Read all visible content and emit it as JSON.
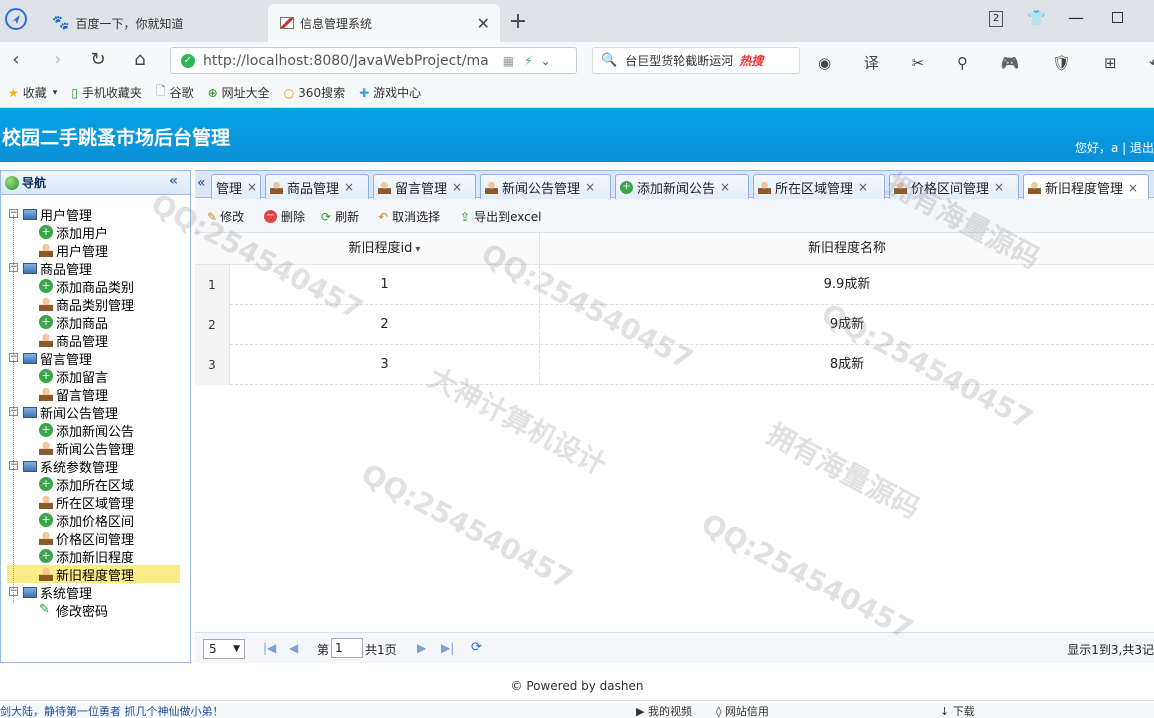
{
  "browser": {
    "tabs": [
      {
        "title": "百度一下，你就知道"
      },
      {
        "title": "信息管理系统"
      }
    ],
    "tab_count": "2",
    "url": "http://localhost:8080/JavaWebProject/ma",
    "search_text": "台巨型货轮截断运河",
    "hot_label": "热搜",
    "bookmarks": [
      "收藏",
      "手机收藏夹",
      "谷歌",
      "网址大全",
      "360搜索",
      "游戏中心"
    ]
  },
  "app": {
    "title": "校园二手跳蚤市场后台管理",
    "welcome": "您好，a | 退出"
  },
  "nav": {
    "header": "导航",
    "groups": [
      {
        "label": "用户管理",
        "items": [
          "添加用户",
          "用户管理"
        ]
      },
      {
        "label": "商品管理",
        "items": [
          "添加商品类别",
          "商品类别管理",
          "添加商品",
          "商品管理"
        ]
      },
      {
        "label": "留言管理",
        "items": [
          "添加留言",
          "留言管理"
        ]
      },
      {
        "label": "新闻公告管理",
        "items": [
          "添加新闻公告",
          "新闻公告管理"
        ]
      },
      {
        "label": "系统参数管理",
        "items": [
          "添加所在区域",
          "所在区域管理",
          "添加价格区间",
          "价格区间管理",
          "添加新旧程度",
          "新旧程度管理"
        ]
      },
      {
        "label": "系统管理",
        "items": [
          "修改密码"
        ]
      }
    ]
  },
  "tabs": [
    {
      "label": "管理"
    },
    {
      "label": "商品管理"
    },
    {
      "label": "留言管理"
    },
    {
      "label": "新闻公告管理"
    },
    {
      "label": "添加新闻公告"
    },
    {
      "label": "所在区域管理"
    },
    {
      "label": "价格区间管理"
    },
    {
      "label": "新旧程度管理"
    }
  ],
  "toolbar": {
    "edit": "修改",
    "delete": "删除",
    "refresh": "刷新",
    "cancel_select": "取消选择",
    "export": "导出到excel"
  },
  "grid": {
    "columns": [
      "新旧程度id",
      "新旧程度名称"
    ],
    "rows": [
      {
        "num": "1",
        "id": "1",
        "name": "9.9成新"
      },
      {
        "num": "2",
        "id": "2",
        "name": "9成新"
      },
      {
        "num": "3",
        "id": "3",
        "name": "8成新"
      }
    ]
  },
  "pager": {
    "page_size": "5",
    "page_label": "第",
    "page_value": "1",
    "total_pages": "共1页",
    "summary": "显示1到3,共3记"
  },
  "footer": {
    "text": "© Powered by dashen"
  },
  "statusbar": {
    "left": "剑大陆，静待第一位勇者 抓几个神仙做小弟！",
    "video": "我的视频",
    "site": "网站信用",
    "download": "下载"
  },
  "colors": {
    "header": "#06a3e6",
    "panel_border": "#99bbe8",
    "selected": "#fbec88"
  }
}
